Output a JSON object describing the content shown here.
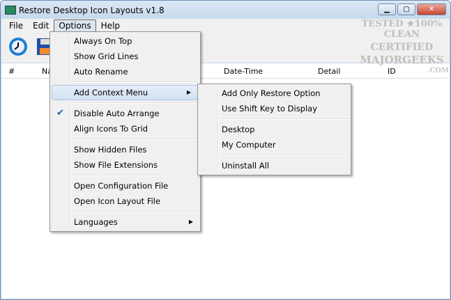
{
  "window": {
    "title": "Restore Desktop Icon Layouts v1.8"
  },
  "menubar": [
    "File",
    "Edit",
    "Options",
    "Help"
  ],
  "columns": [
    "#",
    "Na",
    "Date-Time",
    "Detail",
    "ID"
  ],
  "options_menu": [
    {
      "label": "Always On Top"
    },
    {
      "label": "Show Grid Lines"
    },
    {
      "label": "Auto Rename"
    },
    {
      "sep": true
    },
    {
      "label": "Add Context Menu",
      "submenu": true,
      "highlighted": true
    },
    {
      "sep": true
    },
    {
      "label": "Disable Auto Arrange",
      "checked": true
    },
    {
      "label": "Align Icons To Grid"
    },
    {
      "sep": true
    },
    {
      "label": "Show Hidden Files"
    },
    {
      "label": "Show File Extensions"
    },
    {
      "sep": true
    },
    {
      "label": "Open Configuration File"
    },
    {
      "label": "Open Icon Layout File"
    },
    {
      "sep": true
    },
    {
      "label": "Languages",
      "submenu": true
    }
  ],
  "context_submenu": [
    {
      "label": "Add Only Restore Option"
    },
    {
      "label": "Use Shift Key to Display"
    },
    {
      "sep": true
    },
    {
      "label": "Desktop"
    },
    {
      "label": "My Computer"
    },
    {
      "sep": true
    },
    {
      "label": "Uninstall All"
    }
  ],
  "watermark": [
    "TESTED ★100% CLEAN",
    "CERTIFIED",
    "MAJORGEEKS",
    ".COM"
  ]
}
